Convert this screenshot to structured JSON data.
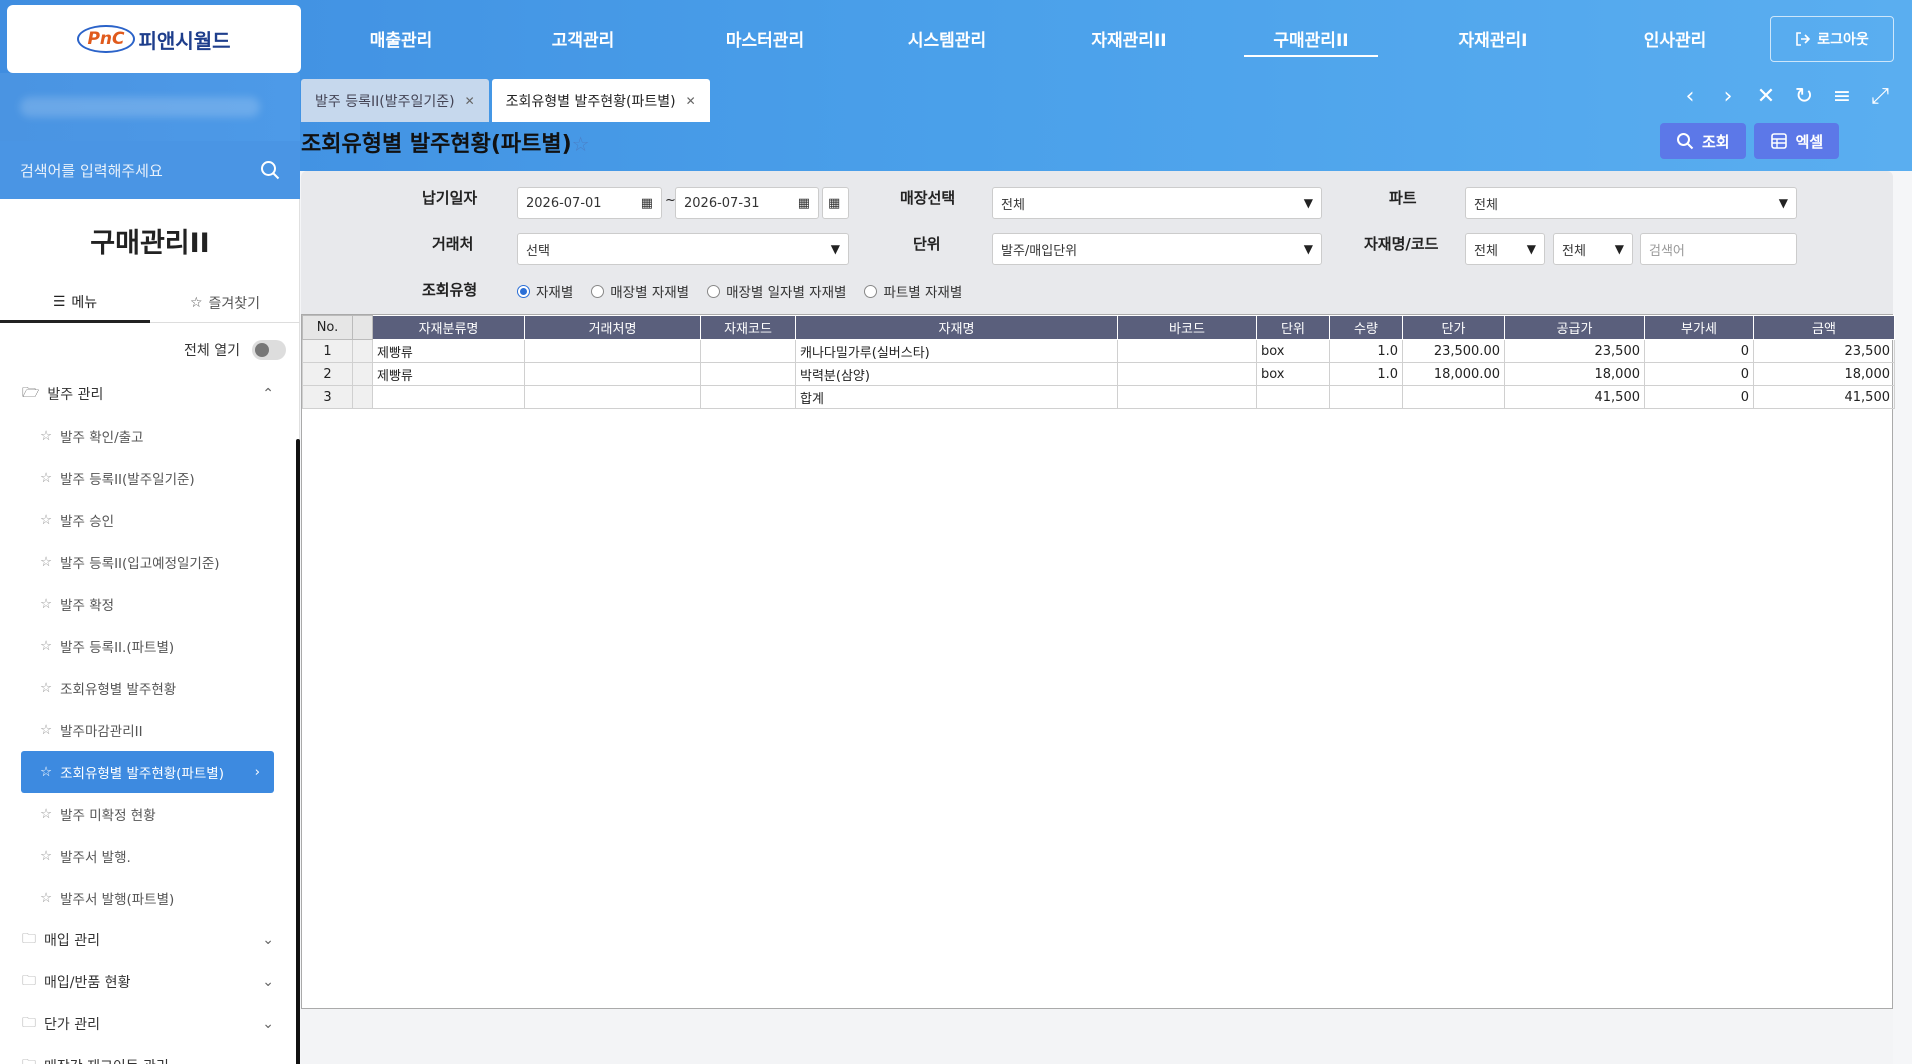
{
  "brand": {
    "mark": "PnC",
    "name": "피앤시월드"
  },
  "topnav": [
    "매출관리",
    "고객관리",
    "마스터관리",
    "시스템관리",
    "자재관리II",
    "구매관리II",
    "자재관리I",
    "인사관리"
  ],
  "topnav_active": 5,
  "logout_label": "로그아웃",
  "sidebar": {
    "search_placeholder": "검색어를 입력해주세요",
    "title": "구매관리II",
    "tab_menu": "메뉴",
    "tab_favorites": "즐겨찾기",
    "expand_all": "전체 열기",
    "group_open": "발주 관리",
    "items": [
      "발주 확인/출고",
      "발주 등록II(발주일기준)",
      "발주 승인",
      "발주 등록II(입고예정일기준)",
      "발주 확정",
      "발주 등록II.(파트별)",
      "조회유형별 발주현황",
      "발주마감관리II",
      "조회유형별 발주현황(파트별)",
      "발주 미확정 현황",
      "발주서 발행.",
      "발주서 발행(파트별)"
    ],
    "active_index": 8,
    "groups_closed": [
      "매입 관리",
      "매입/반품 현황",
      "단가 관리",
      "매장간 재고이동 관리"
    ]
  },
  "tabs": [
    {
      "label": "발주 등록II(발주일기준)",
      "active": false
    },
    {
      "label": "조회유형별 발주현황(파트별)",
      "active": true
    }
  ],
  "page_title": "조회유형별 발주현황(파트별)",
  "actions": {
    "search": "조회",
    "excel": "엑셀"
  },
  "filters": {
    "delivery_date_label": "납기일자",
    "date_from": "2026-07-01",
    "date_to": "2026-07-31",
    "tilde": "~",
    "store_label": "매장선택",
    "store_value": "전체",
    "part_label": "파트",
    "part_value": "전체",
    "vendor_label": "거래처",
    "vendor_value": "선택",
    "unit_label": "단위",
    "unit_value": "발주/매입단위",
    "material_label": "자재명/코드",
    "material_sel1": "전체",
    "material_sel2": "전체",
    "material_placeholder": "검색어",
    "query_type_label": "조회유형",
    "query_types": [
      "자재별",
      "매장별 자재별",
      "매장별 일자별 자재별",
      "파트별 자재별"
    ],
    "query_type_selected": 0
  },
  "grid": {
    "columns": [
      "No.",
      "",
      "자재분류명",
      "거래처명",
      "자재코드",
      "자재명",
      "바코드",
      "단위",
      "수량",
      "단가",
      "공급가",
      "부가세",
      "금액"
    ],
    "rows": [
      [
        "1",
        "",
        "제빵류",
        "",
        "",
        "캐나다밀가루(실버스타)",
        "",
        "box",
        "1.0",
        "23,500.00",
        "23,500",
        "0",
        "23,500"
      ],
      [
        "2",
        "",
        "제빵류",
        "",
        "",
        "박력분(삼양)",
        "",
        "box",
        "1.0",
        "18,000.00",
        "18,000",
        "0",
        "18,000"
      ],
      [
        "3",
        "",
        "",
        "",
        "",
        "합계",
        "",
        "",
        "",
        "",
        "41,500",
        "0",
        "41,500"
      ]
    ]
  }
}
